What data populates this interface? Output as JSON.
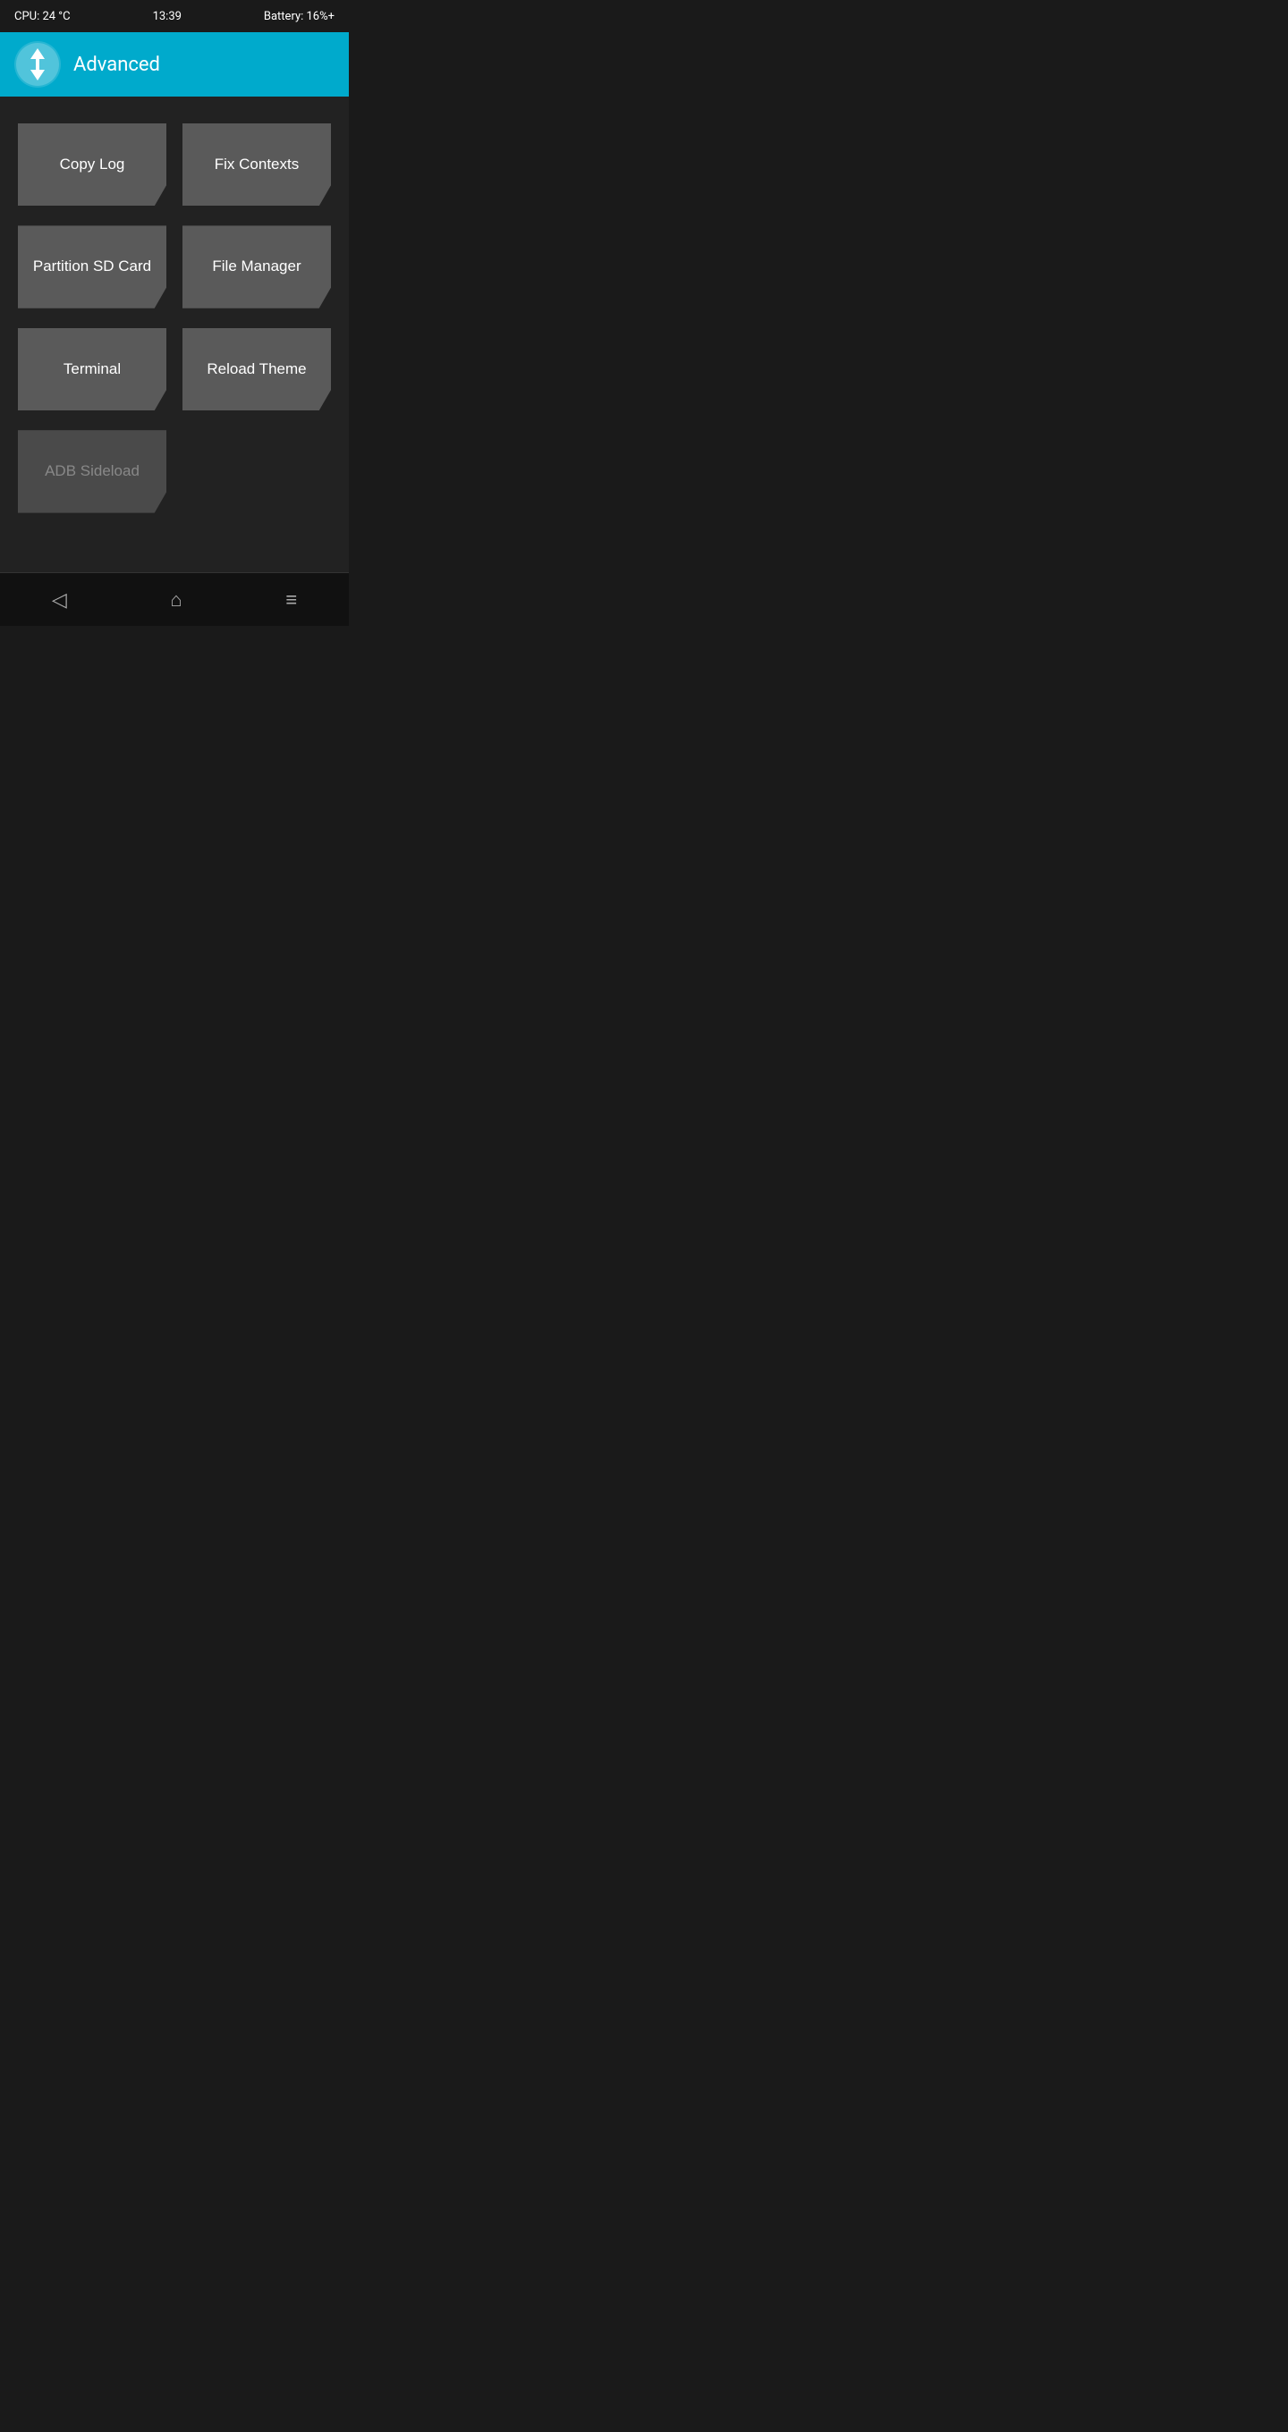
{
  "statusBar": {
    "cpu": "CPU: 24 °C",
    "time": "13:39",
    "battery": "Battery: 16%+"
  },
  "appBar": {
    "title": "Advanced"
  },
  "buttons": [
    {
      "id": "copy-log",
      "label": "Copy Log",
      "disabled": false
    },
    {
      "id": "fix-contexts",
      "label": "Fix Contexts",
      "disabled": false
    },
    {
      "id": "partition-sd-card",
      "label": "Partition SD Card",
      "disabled": false
    },
    {
      "id": "file-manager",
      "label": "File Manager",
      "disabled": false
    },
    {
      "id": "terminal",
      "label": "Terminal",
      "disabled": false
    },
    {
      "id": "reload-theme",
      "label": "Reload Theme",
      "disabled": false
    },
    {
      "id": "adb-sideload",
      "label": "ADB Sideload",
      "disabled": true
    }
  ],
  "bottomNav": {
    "back": "◁",
    "home": "⌂",
    "menu": "≡"
  }
}
